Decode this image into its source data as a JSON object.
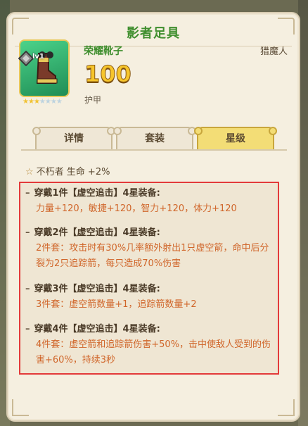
{
  "window": {
    "title": "影者足具"
  },
  "item": {
    "name": "荣耀靴子",
    "level_badge": "lv1",
    "class": "猎魔人",
    "value": "100",
    "stat_label": "护甲",
    "stars": {
      "filled": 3,
      "total": 7
    }
  },
  "tabs": [
    {
      "label": "详情",
      "active": false
    },
    {
      "label": "套装",
      "active": false
    },
    {
      "label": "星级",
      "active": true
    }
  ],
  "bonus": {
    "icon": "star-outline-icon",
    "text": "不朽者 生命 +2%"
  },
  "set_bonuses": [
    {
      "header": "穿戴1件【虚空追击】4星装备:",
      "desc": "力量+120，敏捷+120，智力+120，体力+120"
    },
    {
      "header": "穿戴2件【虚空追击】4星装备:",
      "desc": "2件套：攻击时有30%几率额外射出1只虚空箭，命中后分裂为2只追踪箭，每只造成70%伤害"
    },
    {
      "header": "穿戴3件【虚空追击】4星装备:",
      "desc": "3件套：虚空箭数量+1，追踪箭数量+2"
    },
    {
      "header": "穿戴4件【虚空追击】4星装备:",
      "desc": "4件套：虚空箭和追踪箭伤害+50%，击中使敌人受到的伤害+60%，持续3秒"
    }
  ],
  "colors": {
    "title_green": "#3f8e2e",
    "value_gold": "#f6c52c",
    "set_desc_orange": "#d0662a",
    "highlight_red": "#e33a3a",
    "active_tab": "#f3dd76"
  }
}
